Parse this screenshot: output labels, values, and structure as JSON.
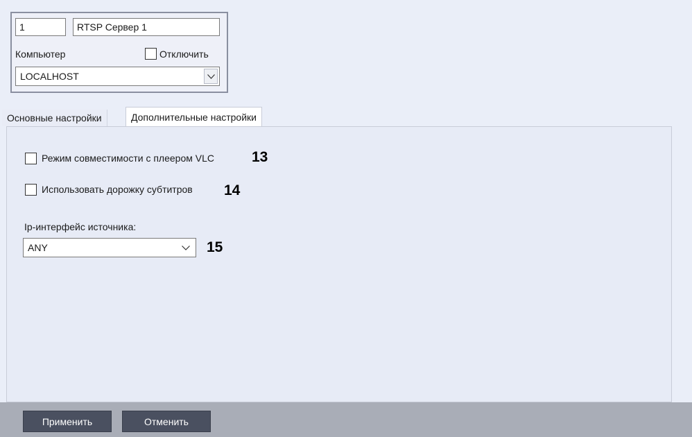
{
  "header": {
    "id_value": "1",
    "name_value": "RTSP Сервер 1",
    "computer_label": "Компьютер",
    "disable_label": "Отключить",
    "computer_value": "LOCALHOST"
  },
  "tabs": [
    {
      "label": "Основные настройки",
      "active": false
    },
    {
      "label": "Дополнительные настройки",
      "active": true
    }
  ],
  "panel": {
    "vlc_mode_label": "Режим совместимости с плеером VLC",
    "vlc_mode_checked": false,
    "vlc_mode_callout": "13",
    "subtitles_label": "Использовать дорожку субтитров",
    "subtitles_checked": false,
    "subtitles_callout": "14",
    "ip_interface_label": "Ip-интерфейс источника:",
    "ip_interface_value": "ANY",
    "ip_interface_callout": "15"
  },
  "footer": {
    "apply_label": "Применить",
    "cancel_label": "Отменить"
  },
  "colors": {
    "background": "#eaeef8",
    "panel": "#e7ebf6",
    "footer_bar": "#a9adb7",
    "button": "#4a5060",
    "button_text": "#ffffff"
  }
}
